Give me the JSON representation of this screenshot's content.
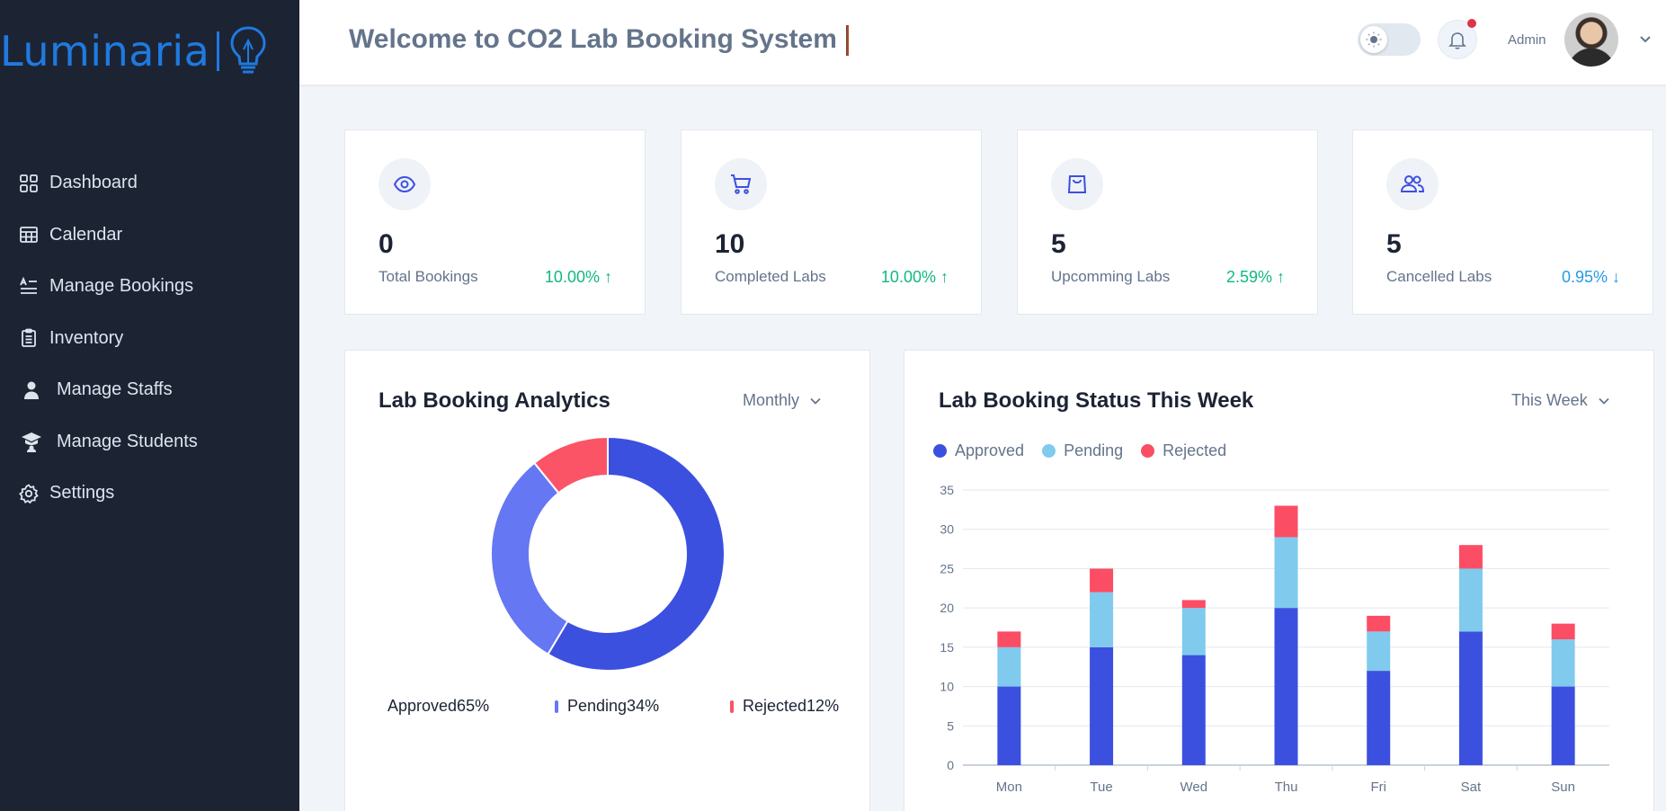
{
  "brand": {
    "name": "Luminaria",
    "color": "#1f7ae0"
  },
  "sidebar": {
    "items": [
      {
        "label": "Dashboard",
        "icon": "grid-icon"
      },
      {
        "label": "Calendar",
        "icon": "calendar-icon"
      },
      {
        "label": "Manage Bookings",
        "icon": "list-icon"
      },
      {
        "label": "Inventory",
        "icon": "clipboard-icon"
      },
      {
        "label": "Manage Staffs",
        "icon": "user-icon"
      },
      {
        "label": "Manage Students",
        "icon": "graduation-cap-icon"
      },
      {
        "label": "Settings",
        "icon": "gear-icon"
      }
    ]
  },
  "header": {
    "title": "Welcome to CO2 Lab Booking System",
    "user_label": "Admin",
    "theme_toggle": "light"
  },
  "cards": [
    {
      "value": "0",
      "label": "Total Bookings",
      "change": "10.00%",
      "trend": "up",
      "icon": "eye-icon"
    },
    {
      "value": "10",
      "label": "Completed Labs",
      "change": "10.00%",
      "trend": "up",
      "icon": "cart-icon"
    },
    {
      "value": "5",
      "label": "Upcomming Labs",
      "change": "2.59%",
      "trend": "up",
      "icon": "bag-icon"
    },
    {
      "value": "5",
      "label": "Cancelled Labs",
      "change": "0.95%",
      "trend": "down",
      "icon": "users-icon"
    }
  ],
  "analytics": {
    "title": "Lab Booking Analytics",
    "period": "Monthly",
    "legend": [
      {
        "label": "Approved65%"
      },
      {
        "label": "Pending34%"
      },
      {
        "label": "Rejected12%"
      }
    ]
  },
  "status": {
    "title": "Lab Booking Status This Week",
    "period": "This Week"
  },
  "chart_data": [
    {
      "type": "pie",
      "title": "Lab Booking Analytics",
      "donut": true,
      "categories": [
        "Approved",
        "Pending",
        "Rejected"
      ],
      "values": [
        65,
        34,
        12
      ],
      "colors": [
        "#3c50e0",
        "#6577f3",
        "#fb5467"
      ]
    },
    {
      "type": "bar",
      "stacked": true,
      "title": "Lab Booking Status This Week",
      "categories": [
        "Mon",
        "Tue",
        "Wed",
        "Thu",
        "Fri",
        "Sat",
        "Sun"
      ],
      "series": [
        {
          "name": "Approved",
          "color": "#3c50e0",
          "values": [
            10,
            15,
            14,
            20,
            12,
            17,
            10
          ]
        },
        {
          "name": "Pending",
          "color": "#80caee",
          "values": [
            5,
            7,
            6,
            9,
            5,
            8,
            6
          ]
        },
        {
          "name": "Rejected",
          "color": "#fb4d64",
          "values": [
            2,
            3,
            1,
            4,
            2,
            3,
            2
          ]
        }
      ],
      "ylim": [
        0,
        35
      ],
      "yticks": [
        0,
        5,
        10,
        15,
        20,
        25,
        30,
        35
      ],
      "grid": true,
      "legend": "top-left"
    }
  ]
}
